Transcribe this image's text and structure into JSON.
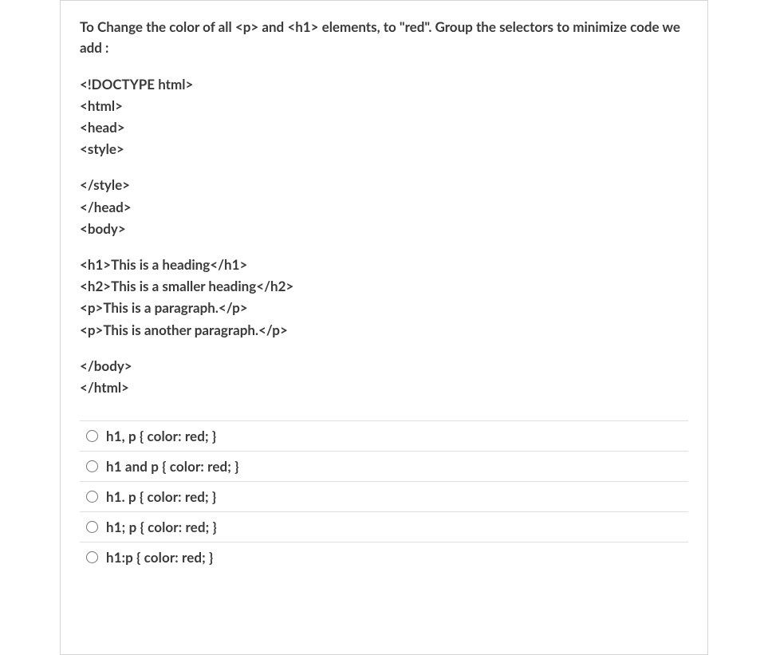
{
  "question": {
    "prompt": " To Change the color of all <p> and <h1> elements, to \"red\". Group the selectors to minimize code we add :",
    "code_lines_1": [
      "<!DOCTYPE html>",
      "<html>",
      "<head>",
      "<style>"
    ],
    "code_lines_2": [
      "</style>",
      "</head>",
      "<body>"
    ],
    "code_lines_3": [
      "<h1>This is a heading</h1>",
      "<h2>This is a smaller heading</h2>",
      "<p>This is a paragraph.</p>",
      "<p>This is another paragraph.</p>"
    ],
    "code_lines_4": [
      "</body>",
      "</html>"
    ]
  },
  "answers": [
    {
      "label": "h1, p { color: red; }"
    },
    {
      "label": "h1 and p { color: red; }"
    },
    {
      "label": "h1. p { color: red; }"
    },
    {
      "label": "h1; p { color: red; }"
    },
    {
      "label": "h1:p { color: red; }"
    }
  ]
}
